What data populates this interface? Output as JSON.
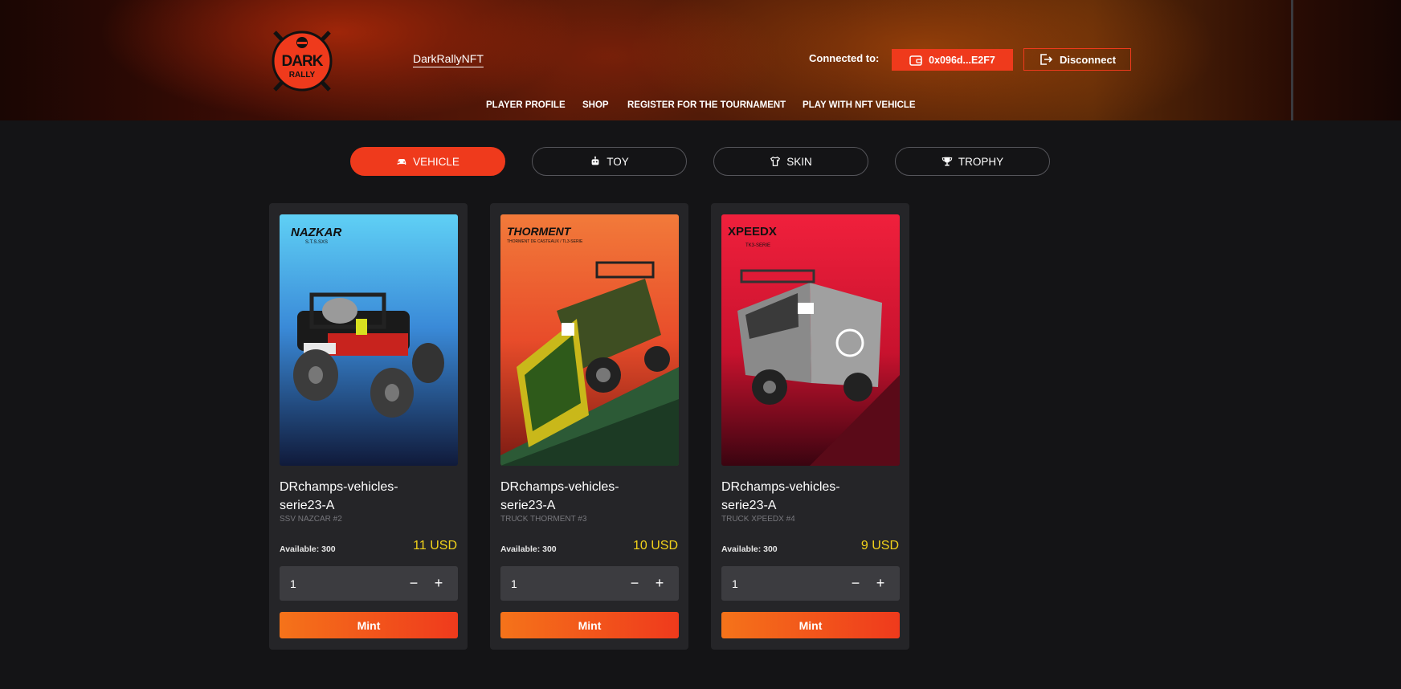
{
  "header": {
    "logo_text": [
      "DARK",
      "RALLY"
    ],
    "brand_link": "DarkRallyNFT",
    "connected_label": "Connected to:",
    "wallet_address": "0x096d...E2F7",
    "disconnect_label": "Disconnect",
    "nav": [
      {
        "label": "PLAYER PROFILE"
      },
      {
        "label": "SHOP"
      },
      {
        "label": "REGISTER FOR THE TOURNAMENT"
      },
      {
        "label": "PLAY WITH NFT VEHICLE"
      }
    ]
  },
  "tabs": [
    {
      "label": "VEHICLE",
      "icon": "car-icon",
      "active": true
    },
    {
      "label": "TOY",
      "icon": "robot-icon",
      "active": false
    },
    {
      "label": "SKIN",
      "icon": "shirt-icon",
      "active": false
    },
    {
      "label": "TROPHY",
      "icon": "trophy-icon",
      "active": false
    }
  ],
  "cards": [
    {
      "brand": "NAZKAR",
      "brand_sub": "S.T.S.SXS",
      "title": "DRchamps-vehicles-serie23-A",
      "subtitle": "SSV NAZCAR #2",
      "available": "Available: 300",
      "price": "11 USD",
      "quantity": "1",
      "mint_label": "Mint"
    },
    {
      "brand": "THORMENT",
      "brand_sub": "THORMENT DE CASTEAUX / TL3-SERIE",
      "title": "DRchamps-vehicles-serie23-A",
      "subtitle": "TRUCK THORMENT #3",
      "available": "Available: 300",
      "price": "10 USD",
      "quantity": "1",
      "mint_label": "Mint"
    },
    {
      "brand": "XPEEDX",
      "brand_sub": "TK3-SERIE",
      "title": "DRchamps-vehicles-serie23-A",
      "subtitle": "TRUCK XPEEDX #4",
      "available": "Available: 300",
      "price": "9 USD",
      "quantity": "1",
      "mint_label": "Mint"
    }
  ],
  "colors": {
    "accent": "#ef3a1c",
    "price": "#f2d21a",
    "background": "#141416",
    "card": "#252528"
  }
}
